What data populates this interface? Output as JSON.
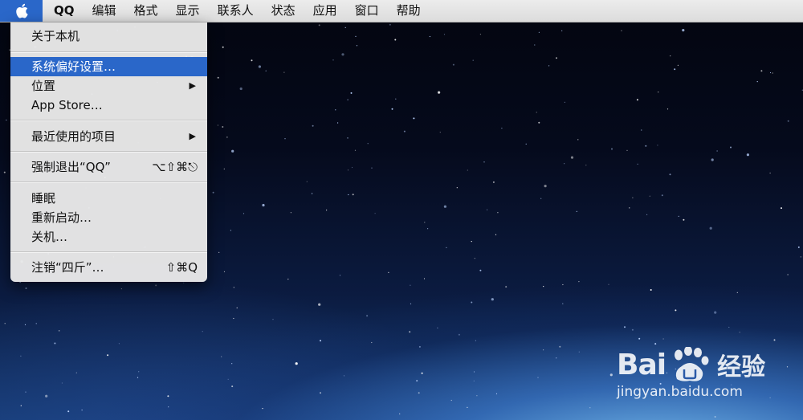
{
  "menubar": {
    "apple_icon": "apple-logo-icon",
    "app_name": "QQ",
    "items": [
      "编辑",
      "格式",
      "显示",
      "联系人",
      "状态",
      "应用",
      "窗口",
      "帮助"
    ]
  },
  "apple_menu": {
    "about": "关于本机",
    "system_prefs": "系统偏好设置…",
    "location": "位置",
    "app_store": "App Store…",
    "recent_items": "最近使用的项目",
    "force_quit": "强制退出“QQ”",
    "force_quit_shortcut": "⌥⇧⌘⎋",
    "sleep": "睡眠",
    "restart": "重新启动…",
    "shutdown": "关机…",
    "logout": "注销“四斤”…",
    "logout_shortcut": "⇧⌘Q",
    "highlighted": "系统偏好设置…"
  },
  "watermark": {
    "brand_left": "Bai",
    "brand_right": "经验",
    "url": "jingyan.baidu.com"
  },
  "colors": {
    "highlight": "#2a67c9",
    "menu_bg": "#e8e8e8",
    "menubar_bg": "#e4e4e4"
  }
}
